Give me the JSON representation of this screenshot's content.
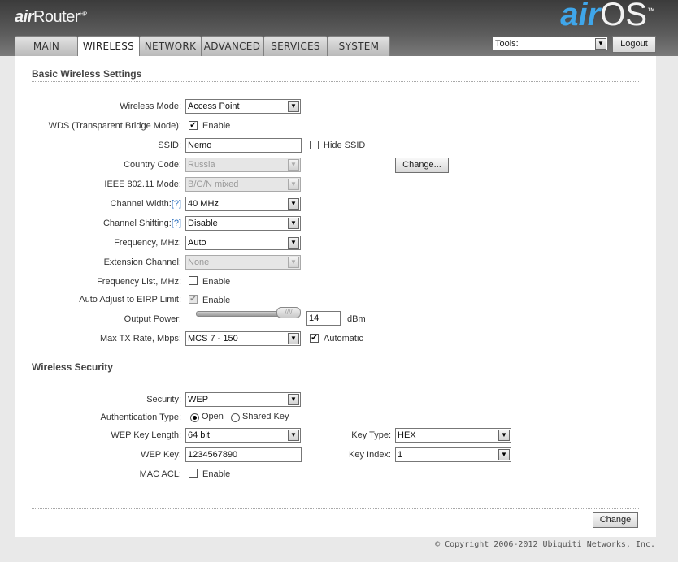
{
  "header": {
    "logo_left_air": "air",
    "logo_left_router": "Router",
    "logo_left_sup": "HP",
    "logo_right_air": "air",
    "logo_right_os": "OS",
    "logo_right_sup": "™",
    "tabs": [
      "MAIN",
      "WIRELESS",
      "NETWORK",
      "ADVANCED",
      "SERVICES",
      "SYSTEM"
    ],
    "active_tab": "WIRELESS",
    "tools_value": "Tools:",
    "logout_label": "Logout"
  },
  "basic": {
    "title": "Basic Wireless Settings",
    "wireless_mode": {
      "label": "Wireless Mode:",
      "value": "Access Point"
    },
    "wds": {
      "label": "WDS (Transparent Bridge Mode):",
      "checked": true,
      "text": "Enable"
    },
    "ssid": {
      "label": "SSID:",
      "value": "Nemo",
      "hide_label": "Hide SSID",
      "hide_checked": false
    },
    "country": {
      "label": "Country Code:",
      "value": "Russia",
      "button": "Change..."
    },
    "ieee": {
      "label": "IEEE 802.11 Mode:",
      "value": "B/G/N mixed"
    },
    "channel_width": {
      "label": "Channel Width:",
      "help": "[?]",
      "value": "40 MHz"
    },
    "channel_shifting": {
      "label": "Channel Shifting:",
      "help": "[?]",
      "value": "Disable"
    },
    "frequency": {
      "label": "Frequency, MHz:",
      "value": "Auto"
    },
    "extension": {
      "label": "Extension Channel:",
      "value": "None"
    },
    "freq_list": {
      "label": "Frequency List, MHz:",
      "checked": false,
      "text": "Enable"
    },
    "eirp": {
      "label": "Auto Adjust to EIRP Limit:",
      "checked": true,
      "text": "Enable"
    },
    "output_power": {
      "label": "Output Power:",
      "value": "14",
      "unit": "dBm",
      "slider_grip": "////"
    },
    "max_tx": {
      "label": "Max TX Rate, Mbps:",
      "value": "MCS 7 - 150",
      "auto_checked": true,
      "auto_text": "Automatic"
    }
  },
  "security": {
    "title": "Wireless Security",
    "security": {
      "label": "Security:",
      "value": "WEP"
    },
    "auth": {
      "label": "Authentication Type:",
      "open": "Open",
      "shared": "Shared Key",
      "selected": "Open"
    },
    "wep_len": {
      "label": "WEP Key Length:",
      "value": "64 bit"
    },
    "key_type": {
      "label": "Key Type:",
      "value": "HEX"
    },
    "wep_key": {
      "label": "WEP Key:",
      "value": "1234567890"
    },
    "key_index": {
      "label": "Key Index:",
      "value": "1"
    },
    "mac_acl": {
      "label": "MAC ACL:",
      "checked": false,
      "text": "Enable"
    }
  },
  "actions": {
    "change_label": "Change"
  },
  "footer": {
    "copyright": "© Copyright 2006-2012 Ubiquiti Networks, Inc."
  },
  "glyphs": {
    "arrow": "▼",
    "check": "✔"
  }
}
